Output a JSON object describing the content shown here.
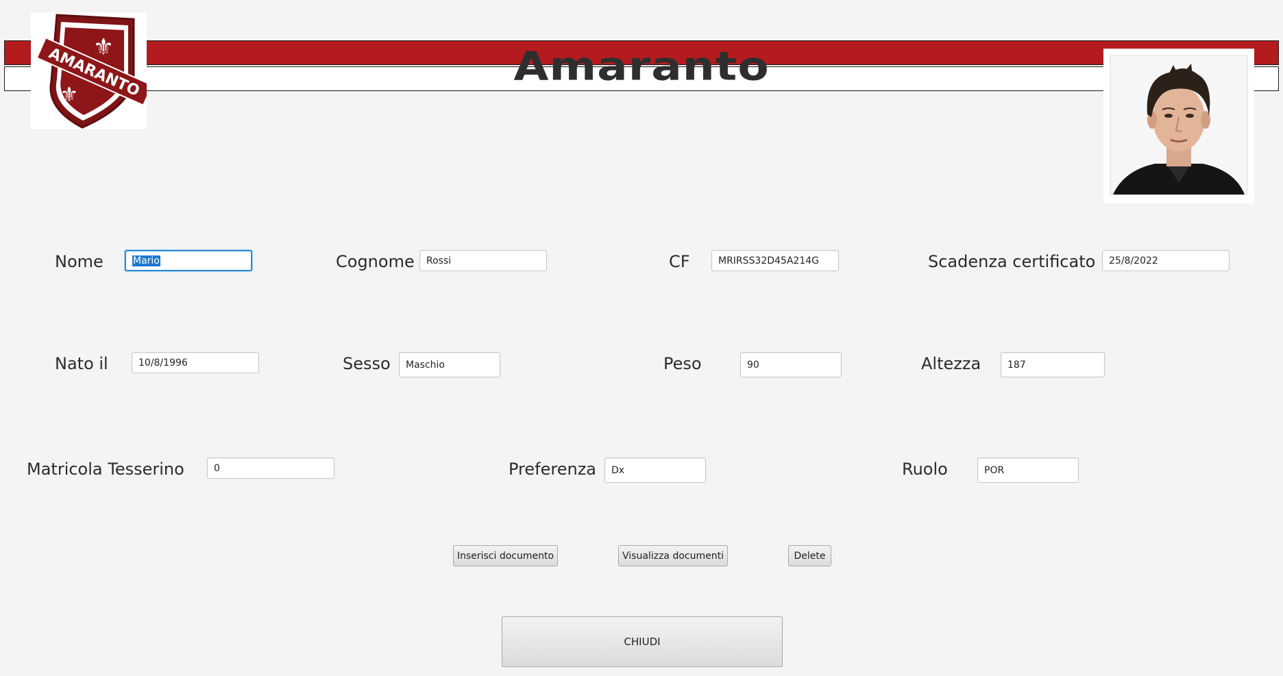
{
  "app": {
    "title": "Amaranto",
    "logo_text": "AMARANTO",
    "colors": {
      "brand_red": "#b41b1e",
      "focus_blue": "#2a8bd6"
    }
  },
  "form": {
    "nome": {
      "label": "Nome",
      "value": "Mario"
    },
    "cognome": {
      "label": "Cognome",
      "value": "Rossi"
    },
    "cf": {
      "label": "CF",
      "value": "MRIRSS32D45A214G"
    },
    "scadenza": {
      "label": "Scadenza certificato",
      "value": "25/8/2022"
    },
    "nato_il": {
      "label": "Nato il",
      "value": "10/8/1996"
    },
    "sesso": {
      "label": "Sesso",
      "value": "Maschio"
    },
    "peso": {
      "label": "Peso",
      "value": "90"
    },
    "altezza": {
      "label": "Altezza",
      "value": "187"
    },
    "matricola": {
      "label": "Matricola Tesserino",
      "value": "0"
    },
    "preferenza": {
      "label": "Preferenza",
      "value": "Dx"
    },
    "ruolo": {
      "label": "Ruolo",
      "value": "POR"
    }
  },
  "actions": {
    "inserisci": "Inserisci documento",
    "visualizza": "Visualizza documenti",
    "delete": "Delete",
    "chiudi": "CHIUDI"
  }
}
